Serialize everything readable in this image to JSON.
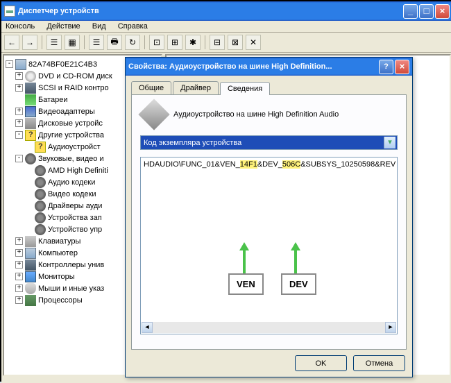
{
  "main_window": {
    "title": "Диспетчер устройств",
    "menu": {
      "console": "Консоль",
      "action": "Действие",
      "view": "Вид",
      "help": "Справка"
    }
  },
  "tree": {
    "root": "82A74BF0E21C4B3",
    "items": [
      {
        "l": 1,
        "exp": "+",
        "i": "dvd",
        "t": "DVD и CD-ROM диск"
      },
      {
        "l": 1,
        "exp": "+",
        "i": "scsi",
        "t": "SCSI и RAID контро"
      },
      {
        "l": 1,
        "exp": "",
        "i": "bat",
        "t": "Батареи"
      },
      {
        "l": 1,
        "exp": "+",
        "i": "vid",
        "t": "Видеоадаптеры"
      },
      {
        "l": 1,
        "exp": "+",
        "i": "disk",
        "t": "Дисковые устройс"
      },
      {
        "l": 1,
        "exp": "-",
        "i": "unk",
        "t": "Другие устройства"
      },
      {
        "l": 2,
        "exp": "",
        "i": "unk",
        "t": "Аудиоустройст"
      },
      {
        "l": 1,
        "exp": "-",
        "i": "snd",
        "t": "Звуковые, видео и"
      },
      {
        "l": 2,
        "exp": "",
        "i": "snd",
        "t": "AMD High Definiti"
      },
      {
        "l": 2,
        "exp": "",
        "i": "snd",
        "t": "Аудио кодеки"
      },
      {
        "l": 2,
        "exp": "",
        "i": "snd",
        "t": "Видео кодеки"
      },
      {
        "l": 2,
        "exp": "",
        "i": "snd",
        "t": "Драйверы ауди"
      },
      {
        "l": 2,
        "exp": "",
        "i": "snd",
        "t": "Устройства зап"
      },
      {
        "l": 2,
        "exp": "",
        "i": "snd",
        "t": "Устройство упр"
      },
      {
        "l": 1,
        "exp": "+",
        "i": "kb",
        "t": "Клавиатуры"
      },
      {
        "l": 1,
        "exp": "+",
        "i": "pc",
        "t": "Компьютер"
      },
      {
        "l": 1,
        "exp": "+",
        "i": "scsi",
        "t": "Контроллеры унив"
      },
      {
        "l": 1,
        "exp": "+",
        "i": "mon",
        "t": "Мониторы"
      },
      {
        "l": 1,
        "exp": "+",
        "i": "mouse",
        "t": "Мыши и иные указ"
      },
      {
        "l": 1,
        "exp": "+",
        "i": "cpu",
        "t": "Процессоры"
      }
    ]
  },
  "props": {
    "title": "Свойства: Аудиоустройство на шине High Definition...",
    "tabs": {
      "general": "Общие",
      "driver": "Драйвер",
      "details": "Сведения"
    },
    "device_name": "Аудиоустройство на шине High Definition Audio",
    "combo": "Код экземпляра устройства",
    "id_pre": "HDAUDIO\\FUNC_01&VEN_",
    "id_ven": "14F1",
    "id_mid": "&DEV_",
    "id_dev": "506C",
    "id_post": "&SUBSYS_10250598&REV",
    "annot_ven": "VEN",
    "annot_dev": "DEV",
    "btn_ok": "OK",
    "btn_cancel": "Отмена"
  }
}
